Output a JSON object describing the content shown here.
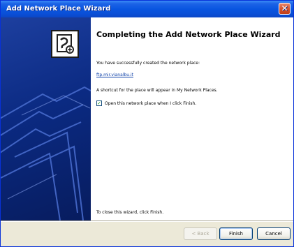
{
  "window": {
    "title": "Add Network Place Wizard",
    "close_glyph": "✕"
  },
  "icons": {
    "close": "close-icon",
    "wizard": "network-place-wizard-icon",
    "folder_art": "folders-graphic",
    "checkbox_check": "check-icon"
  },
  "content": {
    "heading": "Completing the Add Network Place Wizard",
    "line1": "You have successfully created the network place:",
    "place_link": "ftp.mir.vianalbu.it",
    "line2": "A shortcut for the place will appear in My Network Places.",
    "checkbox": {
      "label": "Open this network place when I click Finish.",
      "checked": true,
      "check_glyph": "✓"
    },
    "footer_text": "To close this wizard, click Finish."
  },
  "buttons": {
    "back": "< Back",
    "finish": "Finish",
    "cancel": "Cancel"
  },
  "colors": {
    "titlebar": "#0a52d8",
    "side_panel": "#0b2a82",
    "link": "#0b3fa8",
    "close_button": "#d4532e"
  }
}
